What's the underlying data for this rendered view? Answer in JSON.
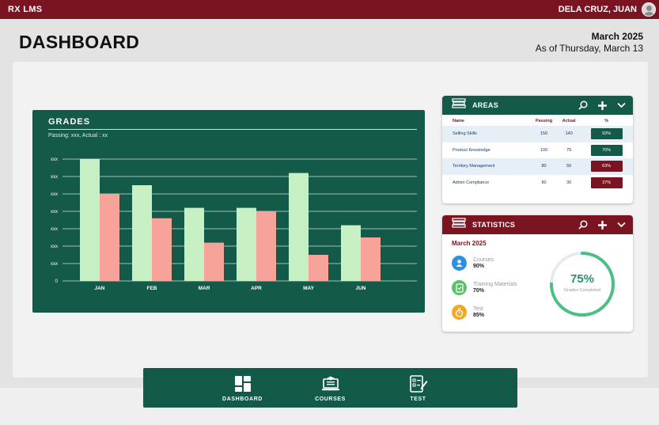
{
  "app": {
    "brand": "RX LMS",
    "user_name": "DELA CRUZ, JUAN"
  },
  "header": {
    "title": "DASHBOARD",
    "month": "March 2025",
    "as_of": "As of Thursday, March 13"
  },
  "grades": {
    "title": "GRADES",
    "subtitle": "Passing: xxx,  Actual : xx"
  },
  "chart_data": {
    "type": "bar",
    "title": "GRADES",
    "categories": [
      "JAN",
      "FEB",
      "MAR",
      "APR",
      "MAY",
      "JUN"
    ],
    "y_tick_labels": [
      "0",
      "xxx",
      "xxx",
      "xxx",
      "xxx",
      "xxx",
      "xxx",
      "xxx"
    ],
    "ylim": [
      0,
      7
    ],
    "grid": true,
    "series": [
      {
        "color": "#c6efc4",
        "values": [
          7.0,
          5.5,
          4.2,
          4.2,
          6.2,
          3.2
        ]
      },
      {
        "color": "#f8a39a",
        "values": [
          5.0,
          3.6,
          2.2,
          4.0,
          1.5,
          2.5
        ]
      }
    ]
  },
  "areas": {
    "title": "AREAS",
    "columns": [
      "Name",
      "Passing",
      "Actual",
      "%"
    ],
    "rows": [
      {
        "name": "Selling Skills",
        "passing": "150",
        "actual": "140",
        "pct": "93%",
        "color": "#135a48"
      },
      {
        "name": "Product Knowledge",
        "passing": "100",
        "actual": "70",
        "pct": "70%",
        "color": "#135a48"
      },
      {
        "name": "Territory Management",
        "passing": "80",
        "actual": "50",
        "pct": "63%",
        "color": "#7a1420"
      },
      {
        "name": "Admin Compliance",
        "passing": "80",
        "actual": "30",
        "pct": "37%",
        "color": "#7a1420"
      }
    ]
  },
  "statistics": {
    "title": "STATISTICS",
    "month": "March 2025",
    "items": [
      {
        "label": "Courses",
        "value": "90%",
        "icon": "user-icon",
        "color": "#2f8fe0"
      },
      {
        "label": "Training Materials",
        "value": "70%",
        "icon": "document-icon",
        "color": "#5cc06a"
      },
      {
        "label": "Test",
        "value": "85%",
        "icon": "stopwatch-icon",
        "color": "#f5a623"
      }
    ],
    "completion_percent": "75%",
    "completion_fraction": 0.75,
    "completion_label": "Grades Completed"
  },
  "nav": {
    "items": [
      {
        "label": "DASHBOARD",
        "icon": "dashboard-icon"
      },
      {
        "label": "COURSES",
        "icon": "courses-icon"
      },
      {
        "label": "TEST",
        "icon": "test-icon"
      }
    ]
  }
}
